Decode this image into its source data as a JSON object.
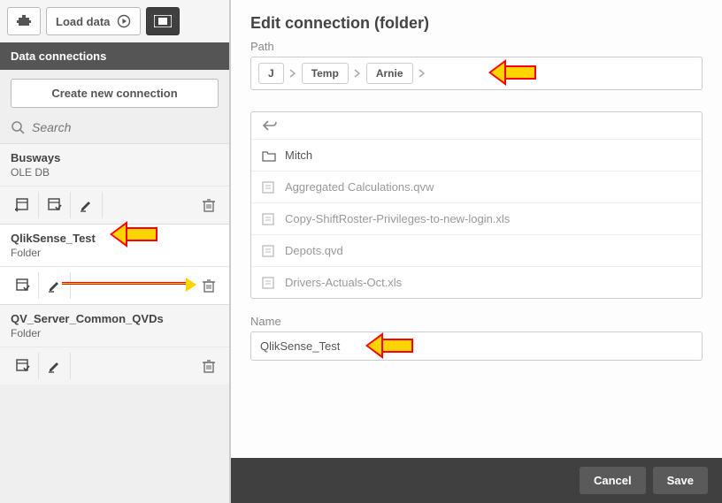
{
  "toolbar": {
    "load_data_label": "Load data"
  },
  "sidebar": {
    "header": "Data connections",
    "create_label": "Create new connection",
    "search_placeholder": "Search"
  },
  "connections": [
    {
      "title": "Busways",
      "sub": "OLE DB",
      "actions": [
        "insert",
        "select",
        "edit"
      ],
      "highlight": false
    },
    {
      "title": "QlikSense_Test",
      "sub": "Folder",
      "actions": [
        "select",
        "edit"
      ],
      "highlight": true
    },
    {
      "title": "QV_Server_Common_QVDs",
      "sub": "Folder",
      "actions": [
        "select",
        "edit"
      ],
      "highlight": false
    }
  ],
  "dialog": {
    "title": "Edit connection (folder)",
    "path_label": "Path",
    "path_segments": [
      "J",
      "Temp",
      "Arnie"
    ],
    "name_label": "Name",
    "name_value": "QlikSense_Test",
    "cancel_label": "Cancel",
    "save_label": "Save"
  },
  "files": [
    {
      "name": "Mitch",
      "type": "folder"
    },
    {
      "name": "Aggregated Calculations.qvw",
      "type": "file"
    },
    {
      "name": "Copy-ShiftRoster-Privileges-to-new-login.xls",
      "type": "file"
    },
    {
      "name": "Depots.qvd",
      "type": "file"
    },
    {
      "name": "Drivers-Actuals-Oct.xls",
      "type": "file"
    }
  ]
}
